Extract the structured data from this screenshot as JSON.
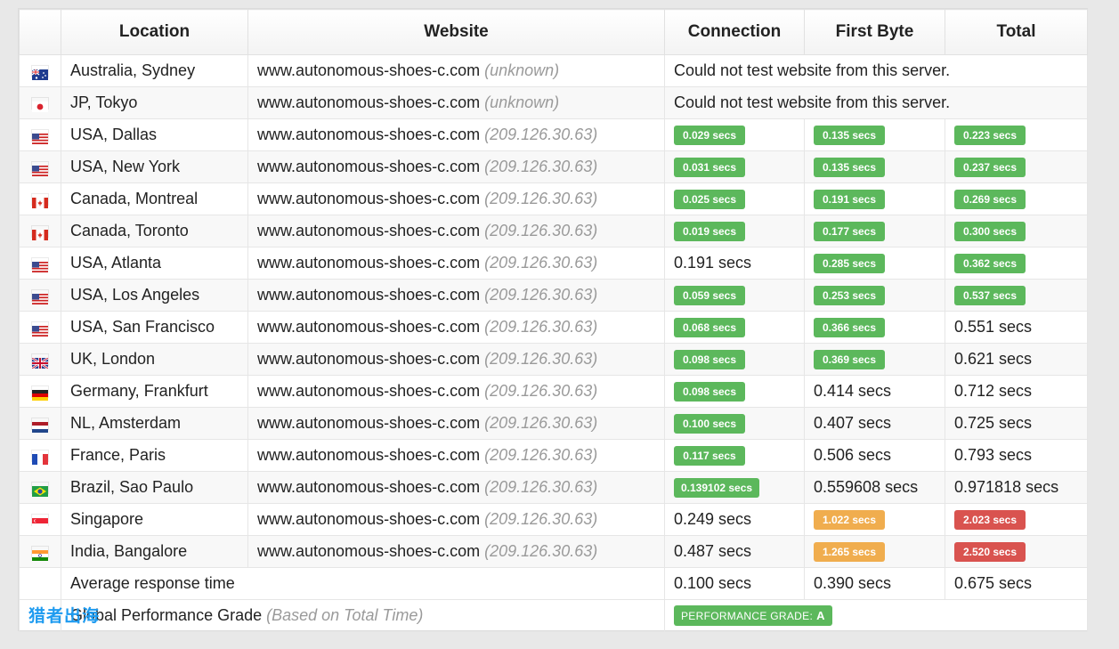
{
  "headers": {
    "location": "Location",
    "website": "Website",
    "connection": "Connection",
    "first_byte": "First Byte",
    "total": "Total"
  },
  "error_message": "Could not test website from this server.",
  "rows": [
    {
      "flag": "au",
      "location": "Australia, Sydney",
      "site": "www.autonomous-shoes-c.com",
      "ip": "(unknown)",
      "error": true
    },
    {
      "flag": "jp",
      "location": "JP, Tokyo",
      "site": "www.autonomous-shoes-c.com",
      "ip": "(unknown)",
      "error": true
    },
    {
      "flag": "us",
      "location": "USA, Dallas",
      "site": "www.autonomous-shoes-c.com",
      "ip": "(209.126.30.63)",
      "connection": {
        "text": "0.029 secs",
        "badge": "green"
      },
      "first_byte": {
        "text": "0.135 secs",
        "badge": "green"
      },
      "total": {
        "text": "0.223 secs",
        "badge": "green"
      }
    },
    {
      "flag": "us",
      "location": "USA, New York",
      "site": "www.autonomous-shoes-c.com",
      "ip": "(209.126.30.63)",
      "connection": {
        "text": "0.031 secs",
        "badge": "green"
      },
      "first_byte": {
        "text": "0.135 secs",
        "badge": "green"
      },
      "total": {
        "text": "0.237 secs",
        "badge": "green"
      }
    },
    {
      "flag": "ca",
      "location": "Canada, Montreal",
      "site": "www.autonomous-shoes-c.com",
      "ip": "(209.126.30.63)",
      "connection": {
        "text": "0.025 secs",
        "badge": "green"
      },
      "first_byte": {
        "text": "0.191 secs",
        "badge": "green"
      },
      "total": {
        "text": "0.269 secs",
        "badge": "green"
      }
    },
    {
      "flag": "ca",
      "location": "Canada, Toronto",
      "site": "www.autonomous-shoes-c.com",
      "ip": "(209.126.30.63)",
      "connection": {
        "text": "0.019 secs",
        "badge": "green"
      },
      "first_byte": {
        "text": "0.177 secs",
        "badge": "green"
      },
      "total": {
        "text": "0.300 secs",
        "badge": "green"
      }
    },
    {
      "flag": "us",
      "location": "USA, Atlanta",
      "site": "www.autonomous-shoes-c.com",
      "ip": "(209.126.30.63)",
      "connection": {
        "text": "0.191 secs",
        "badge": ""
      },
      "first_byte": {
        "text": "0.285 secs",
        "badge": "green"
      },
      "total": {
        "text": "0.362 secs",
        "badge": "green"
      }
    },
    {
      "flag": "us",
      "location": "USA, Los Angeles",
      "site": "www.autonomous-shoes-c.com",
      "ip": "(209.126.30.63)",
      "connection": {
        "text": "0.059 secs",
        "badge": "green"
      },
      "first_byte": {
        "text": "0.253 secs",
        "badge": "green"
      },
      "total": {
        "text": "0.537 secs",
        "badge": "green"
      }
    },
    {
      "flag": "us",
      "location": "USA, San Francisco",
      "site": "www.autonomous-shoes-c.com",
      "ip": "(209.126.30.63)",
      "connection": {
        "text": "0.068 secs",
        "badge": "green"
      },
      "first_byte": {
        "text": "0.366 secs",
        "badge": "green"
      },
      "total": {
        "text": "0.551 secs",
        "badge": ""
      }
    },
    {
      "flag": "uk",
      "location": "UK, London",
      "site": "www.autonomous-shoes-c.com",
      "ip": "(209.126.30.63)",
      "connection": {
        "text": "0.098 secs",
        "badge": "green"
      },
      "first_byte": {
        "text": "0.369 secs",
        "badge": "green"
      },
      "total": {
        "text": "0.621 secs",
        "badge": ""
      }
    },
    {
      "flag": "de",
      "location": "Germany, Frankfurt",
      "site": "www.autonomous-shoes-c.com",
      "ip": "(209.126.30.63)",
      "connection": {
        "text": "0.098 secs",
        "badge": "green"
      },
      "first_byte": {
        "text": "0.414 secs",
        "badge": ""
      },
      "total": {
        "text": "0.712 secs",
        "badge": ""
      }
    },
    {
      "flag": "nl",
      "location": "NL, Amsterdam",
      "site": "www.autonomous-shoes-c.com",
      "ip": "(209.126.30.63)",
      "connection": {
        "text": "0.100 secs",
        "badge": "green"
      },
      "first_byte": {
        "text": "0.407 secs",
        "badge": ""
      },
      "total": {
        "text": "0.725 secs",
        "badge": ""
      }
    },
    {
      "flag": "fr",
      "location": "France, Paris",
      "site": "www.autonomous-shoes-c.com",
      "ip": "(209.126.30.63)",
      "connection": {
        "text": "0.117 secs",
        "badge": "green"
      },
      "first_byte": {
        "text": "0.506 secs",
        "badge": ""
      },
      "total": {
        "text": "0.793 secs",
        "badge": ""
      }
    },
    {
      "flag": "br",
      "location": "Brazil, Sao Paulo",
      "site": "www.autonomous-shoes-c.com",
      "ip": "(209.126.30.63)",
      "connection": {
        "text": "0.139102 secs",
        "badge": "green"
      },
      "first_byte": {
        "text": "0.559608 secs",
        "badge": ""
      },
      "total": {
        "text": "0.971818 secs",
        "badge": ""
      }
    },
    {
      "flag": "sg",
      "location": "Singapore",
      "site": "www.autonomous-shoes-c.com",
      "ip": "(209.126.30.63)",
      "connection": {
        "text": "0.249 secs",
        "badge": ""
      },
      "first_byte": {
        "text": "1.022 secs",
        "badge": "orange"
      },
      "total": {
        "text": "2.023 secs",
        "badge": "red"
      }
    },
    {
      "flag": "in",
      "location": "India, Bangalore",
      "site": "www.autonomous-shoes-c.com",
      "ip": "(209.126.30.63)",
      "connection": {
        "text": "0.487 secs",
        "badge": ""
      },
      "first_byte": {
        "text": "1.265 secs",
        "badge": "orange"
      },
      "total": {
        "text": "2.520 secs",
        "badge": "red"
      }
    }
  ],
  "average": {
    "label": "Average response time",
    "connection": "0.100 secs",
    "first_byte": "0.390 secs",
    "total": "0.675 secs"
  },
  "grade": {
    "label": "Global Performance Grade",
    "sub": "(Based on Total Time)",
    "badge_label": "PERFORMANCE GRADE:",
    "badge_value": "A"
  },
  "watermark": "猎者出海",
  "colors": {
    "green": "#5cb85c",
    "orange": "#f0ad4e",
    "red": "#d9534f",
    "ip_gray": "#9a9a9a"
  }
}
